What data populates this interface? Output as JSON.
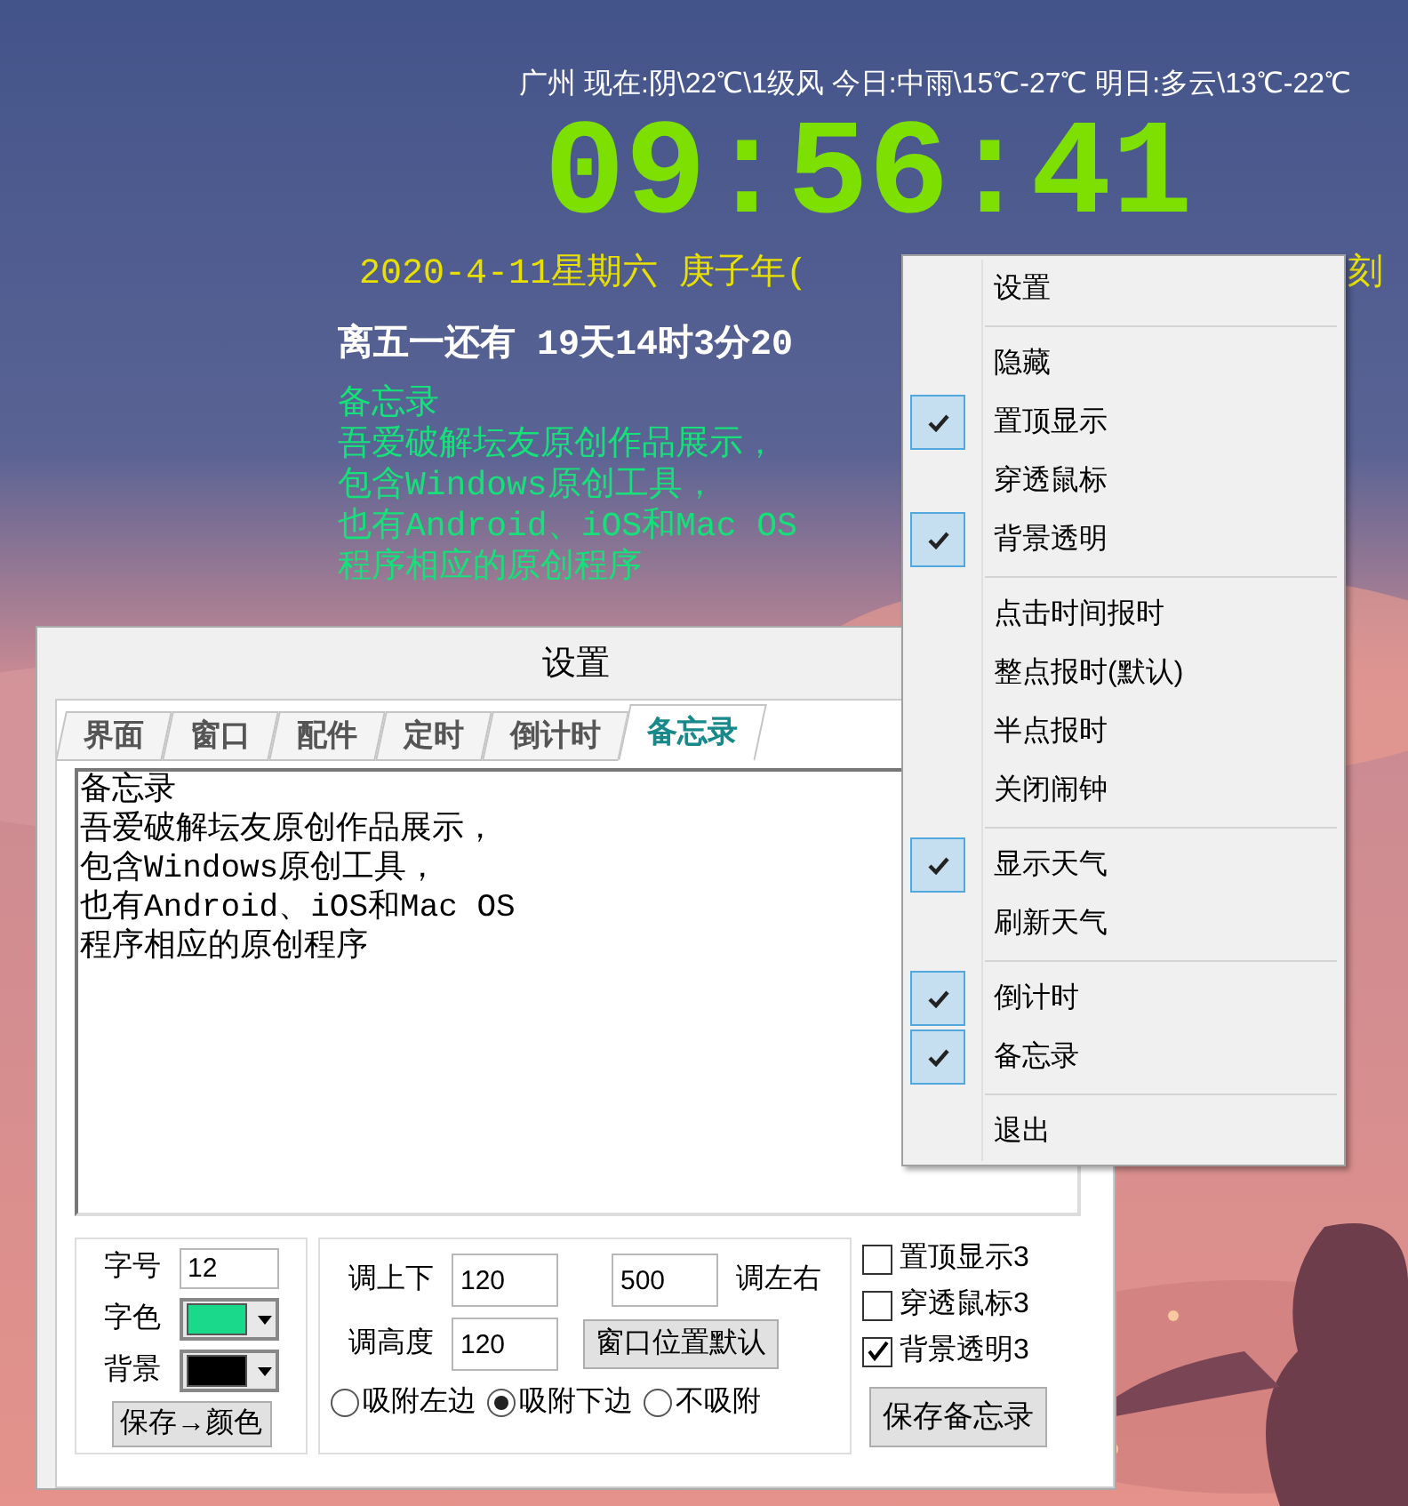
{
  "desktop_widget": {
    "weather": "广州 现在:阴\\22℃\\1级风 今日:中雨\\15℃-27℃ 明日:多云\\13℃-22℃",
    "clock": "09:56:41",
    "date": "2020-4-11星期六 庚子年(",
    "date_end_fragment": "刻",
    "countdown": "离五一还有 19天14时3分20",
    "memo_lines": [
      "备忘录",
      "吾爱破解坛友原创作品展示，",
      "包含Windows原创工具，",
      "也有Android、iOS和Mac OS",
      "程序相应的原创程序"
    ]
  },
  "settings_dialog": {
    "title": "设置",
    "tabs": [
      {
        "label": "界面",
        "selected": false
      },
      {
        "label": "窗口",
        "selected": false
      },
      {
        "label": "配件",
        "selected": false
      },
      {
        "label": "定时",
        "selected": false
      },
      {
        "label": "倒计时",
        "selected": false
      },
      {
        "label": "备忘录",
        "selected": true
      }
    ],
    "memo_text": [
      "备忘录",
      "吾爱破解坛友原创作品展示，",
      "包含Windows原创工具，",
      "也有Android、iOS和Mac OS",
      "程序相应的原创程序"
    ],
    "font_group": {
      "size_label": "字号",
      "size_value": "12",
      "swatches": [
        {
          "label": "字色",
          "color": "#1ad98a"
        },
        {
          "label": "背景",
          "color": "#000000"
        }
      ],
      "save_button": "保存→颜色"
    },
    "position_group": {
      "up_down_label": "调上下",
      "up_down_value": "120",
      "left_right_value": "500",
      "left_right_label": "调左右",
      "height_label": "调高度",
      "height_value": "120",
      "default_button": "窗口位置默认",
      "snap_options": [
        {
          "label": "吸附左边",
          "selected": false
        },
        {
          "label": "吸附下边",
          "selected": true
        },
        {
          "label": "不吸附",
          "selected": false
        }
      ]
    },
    "options": [
      {
        "label": "置顶显示3",
        "checked": false
      },
      {
        "label": "穿透鼠标3",
        "checked": false
      },
      {
        "label": "背景透明3",
        "checked": true
      }
    ],
    "save_memo_button": "保存备忘录"
  },
  "context_menu": [
    {
      "kind": "item",
      "label": "设置",
      "checked": false
    },
    {
      "kind": "separator"
    },
    {
      "kind": "item",
      "label": "隐藏",
      "checked": false
    },
    {
      "kind": "item",
      "label": "置顶显示",
      "checked": true
    },
    {
      "kind": "item",
      "label": "穿透鼠标",
      "checked": false
    },
    {
      "kind": "item",
      "label": "背景透明",
      "checked": true
    },
    {
      "kind": "separator"
    },
    {
      "kind": "item",
      "label": "点击时间报时",
      "checked": false
    },
    {
      "kind": "item",
      "label": "整点报时(默认)",
      "checked": false
    },
    {
      "kind": "item",
      "label": "半点报时",
      "checked": false
    },
    {
      "kind": "item",
      "label": "关闭闹钟",
      "checked": false
    },
    {
      "kind": "separator"
    },
    {
      "kind": "item",
      "label": "显示天气",
      "checked": true
    },
    {
      "kind": "item",
      "label": "刷新天气",
      "checked": false
    },
    {
      "kind": "separator"
    },
    {
      "kind": "item",
      "label": "倒计时",
      "checked": true
    },
    {
      "kind": "item",
      "label": "备忘录",
      "checked": true
    },
    {
      "kind": "separator"
    },
    {
      "kind": "item",
      "label": "退出",
      "checked": false
    }
  ]
}
